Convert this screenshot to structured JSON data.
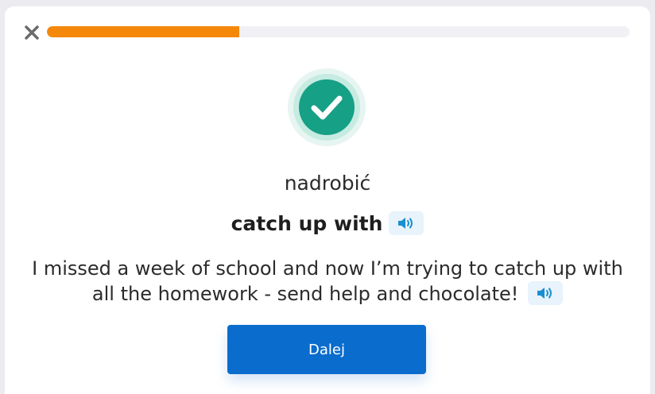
{
  "progress": {
    "value": 0.33
  },
  "icons": {
    "close": "close-icon",
    "success": "checkmark-circle-icon",
    "audio": "speaker-icon"
  },
  "colors": {
    "progress_fill": "#f5880b",
    "success_green": "#16a085",
    "primary_button": "#0a6ccc",
    "audio_icon": "#1a8fd1"
  },
  "card": {
    "word": "nadrobić",
    "phrase": "catch up with",
    "example": "I missed a week of school and now I’m trying to catch up with all the homework - send help and chocolate!"
  },
  "actions": {
    "next_label": "Dalej"
  }
}
